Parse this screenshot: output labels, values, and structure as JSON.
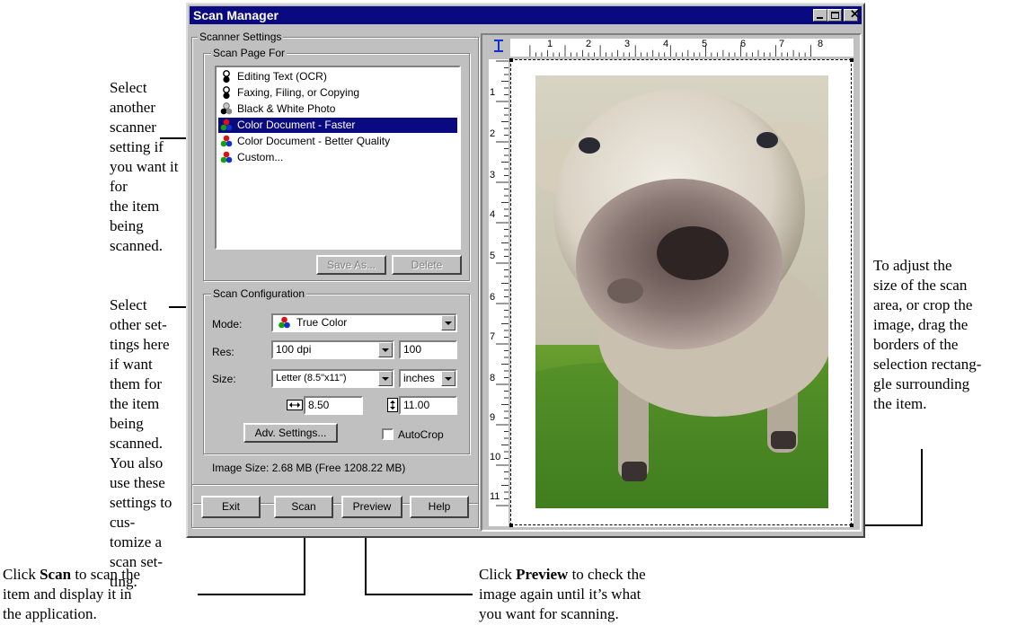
{
  "window": {
    "title": "Scan Manager",
    "scanner_settings_label": "Scanner Settings",
    "scan_page_for_label": "Scan Page For",
    "scan_options": [
      {
        "label": "Editing Text (OCR)",
        "icon": "bw-stack-icon",
        "selected": false
      },
      {
        "label": "Faxing, Filing, or Copying",
        "icon": "bw-stack-icon",
        "selected": false
      },
      {
        "label": "Black & White Photo",
        "icon": "grayscale-circles-icon",
        "selected": false
      },
      {
        "label": "Color Document - Faster",
        "icon": "color-circles-icon",
        "selected": true
      },
      {
        "label": "Color Document - Better Quality",
        "icon": "color-circles-icon",
        "selected": false
      },
      {
        "label": "Custom...",
        "icon": "color-circles-icon",
        "selected": false
      }
    ],
    "save_as_label": "Save As...",
    "delete_label": "Delete",
    "scan_configuration_label": "Scan Configuration",
    "mode_label": "Mode:",
    "mode_value": "True Color",
    "res_label": "Res:",
    "res_value": "100 dpi",
    "res_number": "100",
    "size_label": "Size:",
    "size_value": "Letter (8.5\"x11\")",
    "units_value": "inches",
    "width_value": "8.50",
    "height_value": "11.00",
    "adv_settings_label": "Adv. Settings...",
    "autocrop_label": "AutoCrop",
    "image_size_text": "Image Size: 2.68 MB (Free 1208.22 MB)",
    "exit_label": "Exit",
    "scan_label": "Scan",
    "preview_label": "Preview",
    "help_label": "Help",
    "ruler_numbers": [
      "1",
      "2",
      "3",
      "4",
      "5",
      "6",
      "7",
      "8"
    ],
    "vruler_numbers": [
      "1",
      "2",
      "3",
      "4",
      "5",
      "6",
      "7",
      "8",
      "9",
      "10",
      "11"
    ]
  },
  "annotations": {
    "left_top": [
      "Select another",
      "scanner setting if",
      "you want it for",
      "the item being",
      "scanned."
    ],
    "left_mid": [
      "Select other set-",
      "tings here if want",
      "them for the item",
      "being scanned.",
      "You also use these",
      "settings to cus-",
      "tomize a scan set-",
      "ting."
    ],
    "right": [
      "To adjust the",
      "size of the scan",
      "area, or crop the",
      "image, drag the",
      "borders of the",
      "selection rectang-",
      "gle surrounding",
      "the item."
    ],
    "scan_callout": {
      "prefix": "Click ",
      "bold": "Scan",
      "line1_rest": " to scan the",
      "line2": "item and display it in",
      "line3": "the application."
    },
    "preview_callout": {
      "prefix": "Click ",
      "bold": "Preview",
      "line1_rest": " to check the",
      "line2": "image again until it’s what",
      "line3": "you want for scanning."
    }
  },
  "colors": {
    "title_bar": "#0a0a80",
    "selection": "#0a0a80",
    "face": "#c0c0c0"
  }
}
